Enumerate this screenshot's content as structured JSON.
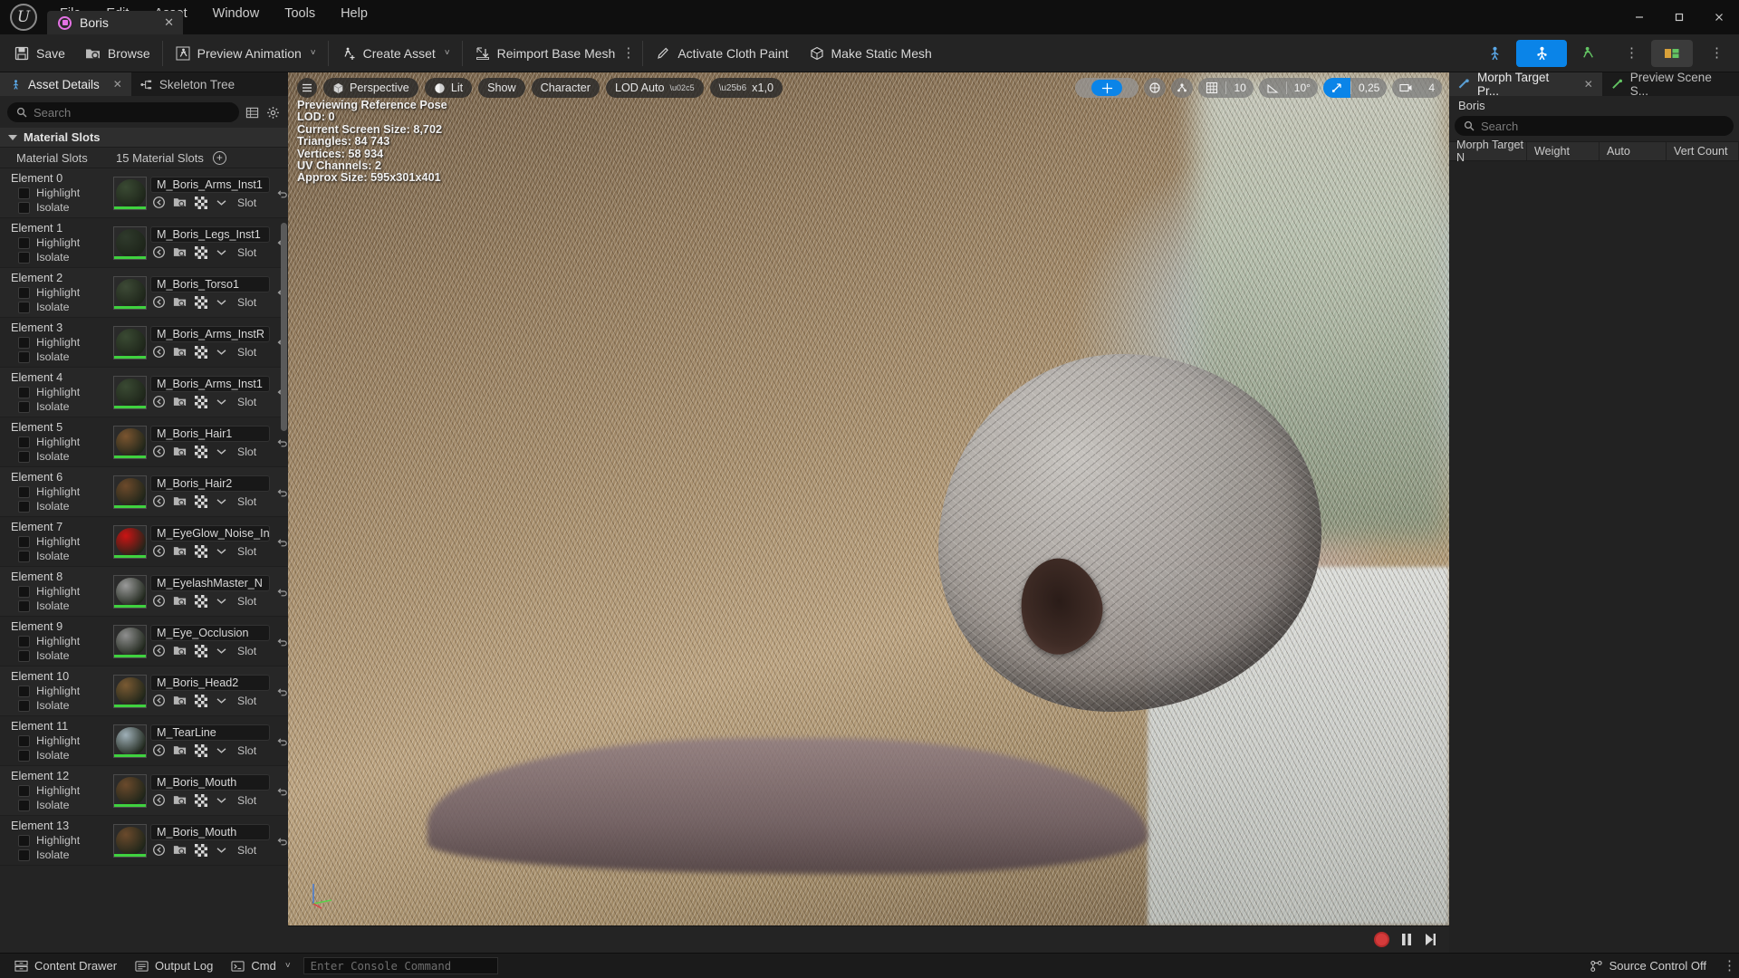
{
  "app": {
    "logo_icon": "unreal-engine-logo",
    "menu": [
      "File",
      "Edit",
      "Asset",
      "Window",
      "Tools",
      "Help"
    ],
    "window_controls": {
      "minimize": "—",
      "maximize": "☐",
      "close": "✕"
    }
  },
  "asset_tab": {
    "label": "Boris",
    "icon": "skeletal-mesh-icon",
    "close": "✕"
  },
  "toolbar": {
    "save_label": "Save",
    "browse_label": "Browse",
    "preview_animation_label": "Preview Animation",
    "create_asset_label": "Create Asset",
    "reimport_base_mesh_label": "Reimport Base Mesh",
    "activate_cloth_paint_label": "Activate Cloth Paint",
    "make_static_mesh_label": "Make Static Mesh",
    "caret": "˅",
    "overflow_dots": "⋮"
  },
  "left_panel": {
    "tabs": [
      {
        "label": "Asset Details",
        "icon": "asset-details-icon",
        "active": true,
        "closable": true
      },
      {
        "label": "Skeleton Tree",
        "icon": "skeleton-tree-icon",
        "active": false,
        "closable": false
      }
    ],
    "close_glyph": "✕",
    "search": {
      "placeholder": "Search",
      "value": "",
      "icon": "search-icon"
    },
    "search_buttons": [
      "grid-view-icon",
      "settings-gear-icon"
    ],
    "section_title": "Material Slots",
    "count_label": "Material Slots",
    "count_value": "15 Material Slots",
    "add_icon": "plus-circle-icon",
    "checkbox_labels": {
      "highlight": "Highlight",
      "isolate": "Isolate"
    },
    "slot_tag": "Slot",
    "row_icons": [
      "browse-to-asset-icon",
      "find-in-content-browser-icon",
      "use-selected-asset-icon",
      "chevron-down-icon"
    ],
    "reset_icon": "reset-arrow-icon",
    "slots": [
      {
        "element": "Element 0",
        "material": "M_Boris_Arms_Inst1",
        "swatch": "#3a4a33"
      },
      {
        "element": "Element 1",
        "material": "M_Boris_Legs_Inst1",
        "swatch": "#2f3a2c"
      },
      {
        "element": "Element 2",
        "material": "M_Boris_Torso1",
        "swatch": "#3d4a36"
      },
      {
        "element": "Element 3",
        "material": "M_Boris_Arms_InstR",
        "swatch": "#3a4a33"
      },
      {
        "element": "Element 4",
        "material": "M_Boris_Arms_Inst1",
        "swatch": "#3a4a33"
      },
      {
        "element": "Element 5",
        "material": "M_Boris_Hair1",
        "swatch": "#7b5530"
      },
      {
        "element": "Element 6",
        "material": "M_Boris_Hair2",
        "swatch": "#6d4a2b"
      },
      {
        "element": "Element 7",
        "material": "M_EyeGlow_Noise_Inst",
        "swatch": "#cc1414"
      },
      {
        "element": "Element 8",
        "material": "M_EyelashMaster_N",
        "swatch": "#9a9a9a"
      },
      {
        "element": "Element 9",
        "material": "M_Eye_Occlusion",
        "swatch": "#8f8f8f"
      },
      {
        "element": "Element 10",
        "material": "M_Boris_Head2",
        "swatch": "#7a5a33"
      },
      {
        "element": "Element 11",
        "material": "M_TearLine",
        "swatch": "#9fb0b8"
      },
      {
        "element": "Element 12",
        "material": "M_Boris_Mouth",
        "swatch": "#6b4a2c"
      },
      {
        "element": "Element 13",
        "material": "M_Boris_Mouth",
        "swatch": "#6b4a2c"
      }
    ]
  },
  "viewport": {
    "menu_icon": "hamburger-menu-icon",
    "camera_label": "Perspective",
    "camera_icon": "cube-icon",
    "lit_label": "Lit",
    "lit_icon": "lighting-sphere-icon",
    "show_label": "Show",
    "character_label": "Character",
    "lod_label": "LOD Auto",
    "playrate_label": "x1,0",
    "play_icon": "play-icon",
    "stats": [
      "Previewing Reference Pose",
      "LOD: 0",
      "Current Screen Size: 8,702",
      "Triangles: 84 743",
      "Vertices: 58 934",
      "UV Channels: 2",
      "Approx Size: 595x301x401"
    ],
    "right_tools": {
      "select_icon": "select-mode-icon",
      "coordinate_icon": "world-coordinate-icon",
      "snap_icon": "snap-joint-icon",
      "grid_icon": "grid-snap-icon",
      "grid_value": "10",
      "angle_icon": "angle-snap-icon",
      "angle_value": "10°",
      "scale_icon": "scale-snap-icon",
      "scale_value": "0,25",
      "camera_speed_icon": "camera-speed-icon",
      "camera_speed_value": "4",
      "accent": "#0a84e8"
    },
    "gizmo_axes": {
      "x": "#d14b4b",
      "y": "#5bd14b",
      "z": "#4b7ed1"
    }
  },
  "playback": {
    "record_icon": "record-icon",
    "pause_icon": "pause-icon",
    "step_icon": "step-forward-icon"
  },
  "right_panel": {
    "tabs": [
      {
        "label": "Morph Target Pr...",
        "icon": "morph-target-icon",
        "active": true,
        "closable": true
      },
      {
        "label": "Preview Scene S...",
        "icon": "preview-scene-icon",
        "active": false,
        "closable": false
      }
    ],
    "close_glyph": "✕",
    "subtitle": "Boris",
    "search": {
      "placeholder": "Search",
      "value": "",
      "icon": "search-icon"
    },
    "columns": [
      "Morph Target N",
      "Weight",
      "Auto",
      "Vert Count"
    ],
    "rows": []
  },
  "statusbar": {
    "content_drawer_label": "Content Drawer",
    "content_drawer_icon": "drawer-icon",
    "output_log_label": "Output Log",
    "output_log_icon": "log-icon",
    "cmd_label": "Cmd",
    "cmd_icon": "console-icon",
    "cmd_caret": "˅",
    "console_placeholder": "Enter Console Command",
    "console_value": "",
    "source_control_label": "Source Control Off",
    "source_control_icon": "source-control-icon",
    "overflow_dots": "⋮"
  }
}
